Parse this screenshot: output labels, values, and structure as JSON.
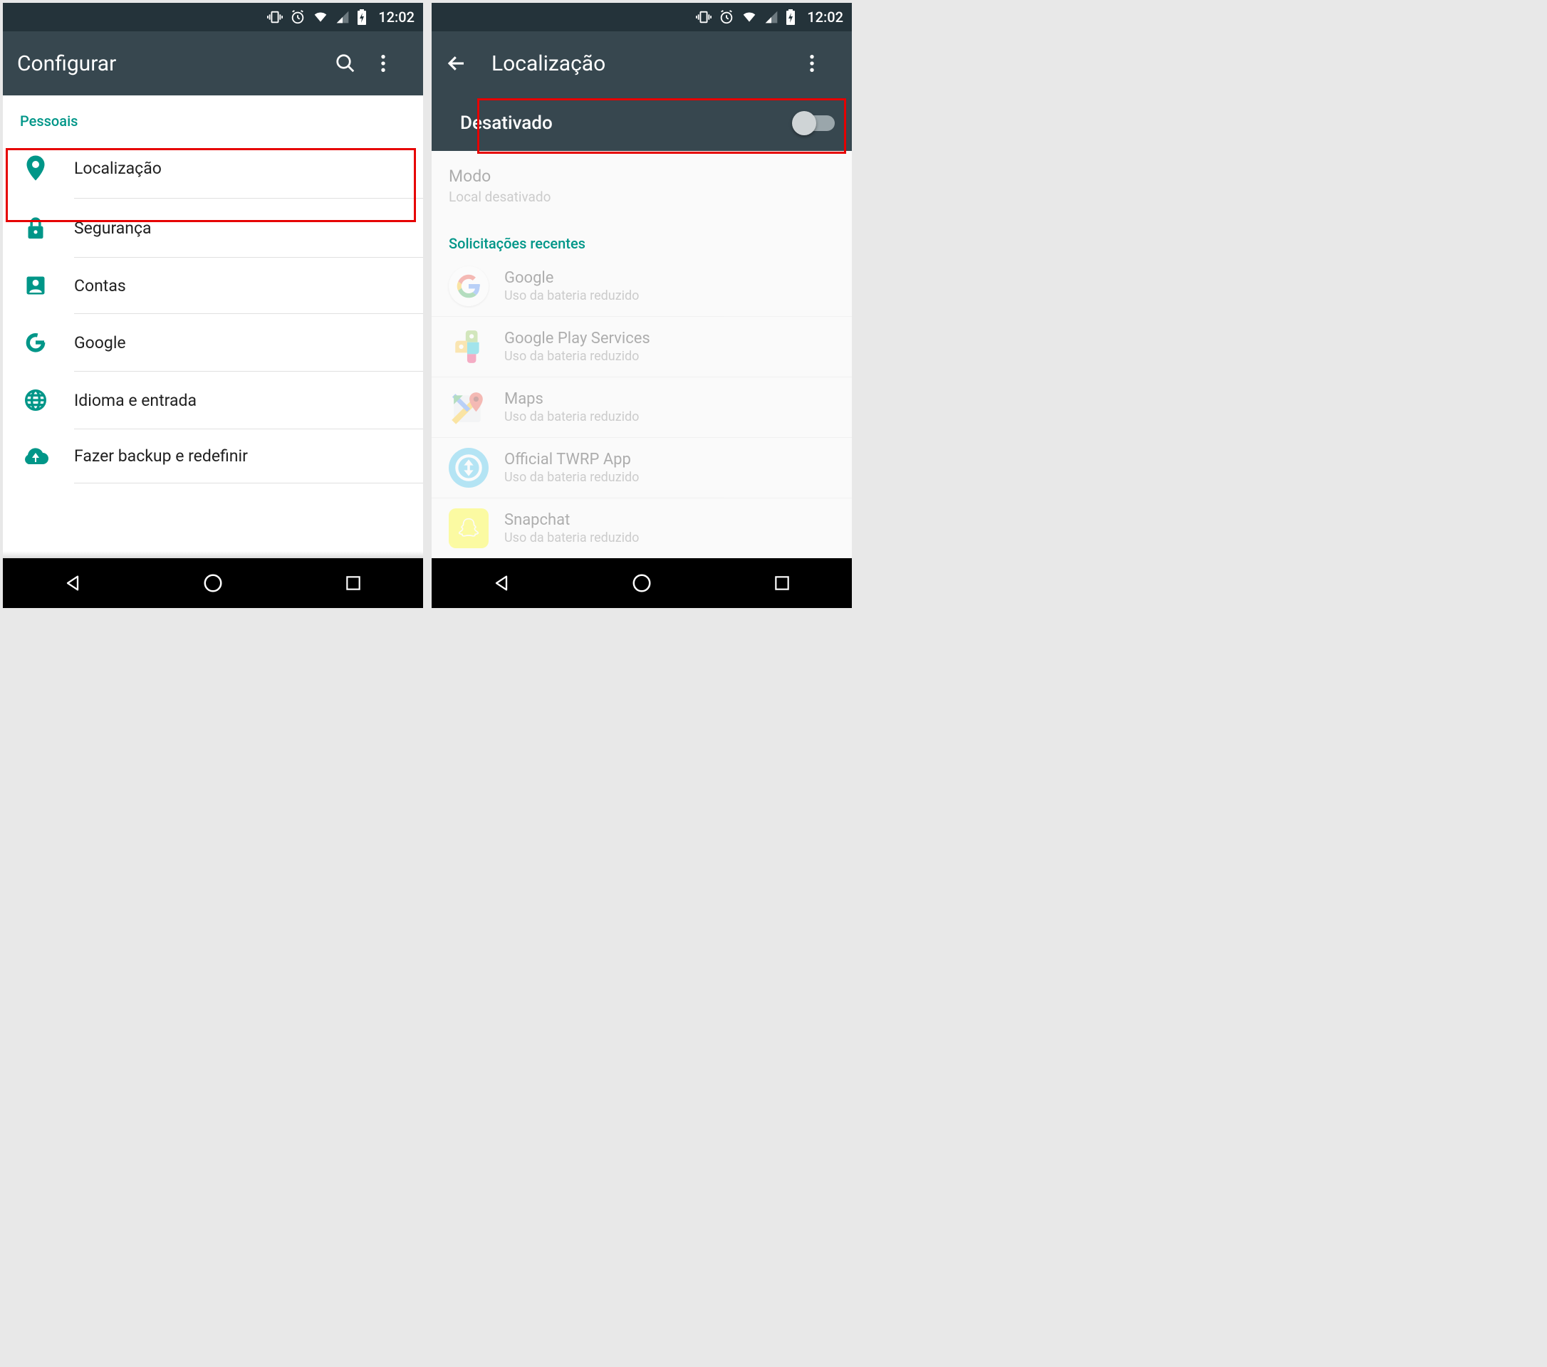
{
  "statusbar": {
    "time": "12:02"
  },
  "left": {
    "title": "Configurar",
    "section": "Pessoais",
    "items": [
      {
        "label": "Localização"
      },
      {
        "label": "Segurança"
      },
      {
        "label": "Contas"
      },
      {
        "label": "Google"
      },
      {
        "label": "Idioma e entrada"
      },
      {
        "label": "Fazer backup e redefinir"
      }
    ]
  },
  "right": {
    "title": "Localização",
    "toggle_label": "Desativado",
    "mode_title": "Modo",
    "mode_sub": "Local desativado",
    "recent_label": "Solicitações recentes",
    "apps": [
      {
        "name": "Google",
        "sub": "Uso da bateria reduzido"
      },
      {
        "name": "Google Play Services",
        "sub": "Uso da bateria reduzido"
      },
      {
        "name": "Maps",
        "sub": "Uso da bateria reduzido"
      },
      {
        "name": "Official TWRP App",
        "sub": "Uso da bateria reduzido"
      },
      {
        "name": "Snapchat",
        "sub": "Uso da bateria reduzido"
      }
    ]
  }
}
